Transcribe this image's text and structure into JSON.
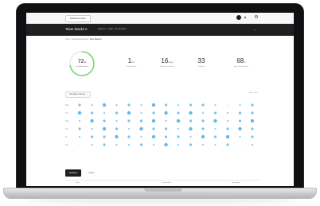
{
  "topbar": {
    "tab_label": "Dashboard Activity",
    "avatar_icon": "user-avatar-icon",
    "more_icon": "dot-icon",
    "settings_icon": "gear-icon"
  },
  "header": {
    "title": "Team Stacks A",
    "subtitle": "Weeks 1–4 · 2018 · Sun, Sep 2017",
    "menu_icon": "chevron-down-icon"
  },
  "breadcrumb": {
    "items": [
      "Home",
      "Dashboard Lessons"
    ],
    "current": "Team Stacks A"
  },
  "summary": {
    "ring": {
      "value": "72",
      "unit": "%",
      "label": "Total Attendance",
      "fraction": 0.72,
      "color": "#7fd37a"
    },
    "stats": [
      {
        "value": "1",
        "unit": "/12",
        "label": "Overall Rank"
      },
      {
        "value": "16",
        "unit": "days",
        "label": "Sessions in Streak"
      },
      {
        "value": "33",
        "unit": "",
        "label": "Checkins"
      },
      {
        "value": "68",
        "unit": "m",
        "label": "Avg Time/Practice"
      }
    ]
  },
  "activity": {
    "filter_label": "Attendance Weekly",
    "filter_icon": "chevron-down-icon",
    "right_label": "All Lessons",
    "row_labels": [
      "Mon",
      "Tue",
      "Wed",
      "Thu",
      "Fri",
      "Sat"
    ],
    "accent": "#63b8e8",
    "levels": [
      [
        2,
        1,
        3,
        1,
        2,
        1,
        3,
        2,
        1,
        2,
        2,
        1,
        0,
        1,
        2
      ],
      [
        3,
        2,
        1,
        2,
        3,
        1,
        2,
        3,
        2,
        3,
        1,
        2,
        1,
        2,
        2
      ],
      [
        1,
        3,
        2,
        1,
        2,
        2,
        3,
        1,
        3,
        2,
        2,
        3,
        1,
        2,
        3
      ],
      [
        2,
        1,
        3,
        2,
        1,
        3,
        2,
        2,
        1,
        3,
        2,
        1,
        2,
        3,
        2
      ],
      [
        1,
        2,
        2,
        3,
        2,
        1,
        3,
        2,
        2,
        1,
        3,
        2,
        3,
        1,
        2
      ],
      [
        0,
        1,
        2,
        1,
        1,
        2,
        1,
        3,
        1,
        2,
        1,
        1,
        2,
        0,
        1
      ]
    ]
  },
  "tabs": {
    "active": "Sessions",
    "inactive": "Notes"
  },
  "table": {
    "headers": [
      "Date",
      "Lesson Note",
      "Description"
    ]
  }
}
